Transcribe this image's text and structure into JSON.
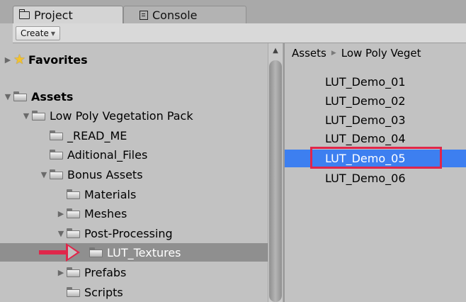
{
  "tabs": {
    "project": "Project",
    "console": "Console"
  },
  "toolbar": {
    "create_label": "Create"
  },
  "tree": {
    "favorites": "Favorites",
    "assets": "Assets",
    "low_poly": "Low Poly Vegetation Pack",
    "read_me": "_READ_ME",
    "aditional": "Aditional_Files",
    "bonus": "Bonus Assets",
    "materials": "Materials",
    "meshes": "Meshes",
    "post": "Post-Processing",
    "lut": "LUT_Textures",
    "prefabs": "Prefabs",
    "scripts": "Scripts"
  },
  "breadcrumb": {
    "root": "Assets",
    "child": "Low Poly Veget"
  },
  "files": [
    "LUT_Demo_01",
    "LUT_Demo_02",
    "LUT_Demo_03",
    "LUT_Demo_04",
    "LUT_Demo_05",
    "LUT_Demo_06"
  ],
  "colors": {
    "selection_blue": "#3d7ff0",
    "annotation_red": "#e0264a",
    "tree_selection_gray": "#8f8f8f"
  }
}
